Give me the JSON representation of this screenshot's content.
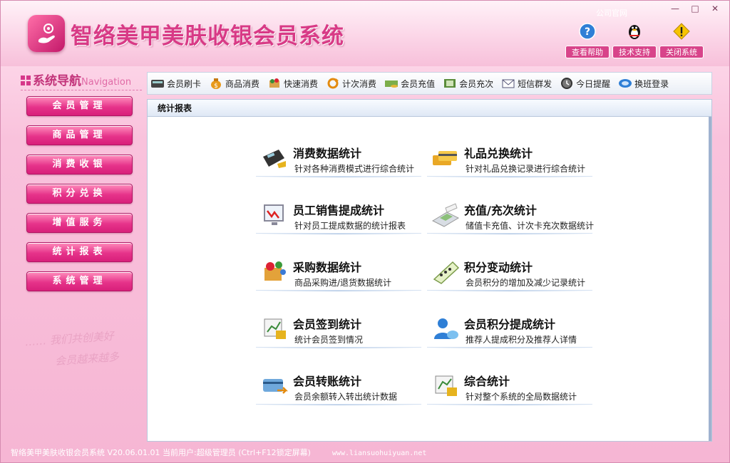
{
  "window": {
    "title": "智络美甲美肤收银会员系统",
    "official_site": "公司官网",
    "controls": [
      "—",
      "□",
      "✕"
    ]
  },
  "header_buttons": [
    {
      "label": "查看帮助",
      "icon": "help-icon"
    },
    {
      "label": "技术支持",
      "icon": "qq-penguin-icon"
    },
    {
      "label": "关闭系统",
      "icon": "warning-icon"
    }
  ],
  "sidebar": {
    "title": "系统导航",
    "title_en": "Navigation",
    "items": [
      {
        "label": "会员管理"
      },
      {
        "label": "商品管理"
      },
      {
        "label": "消费收银"
      },
      {
        "label": "积分兑换"
      },
      {
        "label": "增值服务"
      },
      {
        "label": "统计报表"
      },
      {
        "label": "系统管理"
      }
    ],
    "slogan_line1": "…… 我们共创美好",
    "slogan_line2": "会员越来越多"
  },
  "toolbar": [
    {
      "label": "会员刷卡",
      "icon": "card-reader-icon"
    },
    {
      "label": "商品消费",
      "icon": "money-bag-icon"
    },
    {
      "label": "快速消费",
      "icon": "fast-consume-icon"
    },
    {
      "label": "计次消费",
      "icon": "recycle-icon"
    },
    {
      "label": "会员充值",
      "icon": "recharge-icon"
    },
    {
      "label": "会员充次",
      "icon": "count-recharge-icon"
    },
    {
      "label": "短信群发",
      "icon": "sms-envelope-icon"
    },
    {
      "label": "今日提醒",
      "icon": "clock-icon"
    },
    {
      "label": "换班登录",
      "icon": "shift-login-icon"
    }
  ],
  "main": {
    "section_title": "统计报表",
    "stats": [
      {
        "title": "消费数据统计",
        "desc": "针对各种消费模式进行综合统计",
        "icon": "pos-machine-icon"
      },
      {
        "title": "礼品兑换统计",
        "desc": "针对礼品兑换记录进行综合统计",
        "icon": "cards-icon"
      },
      {
        "title": "员工销售提成统计",
        "desc": "针对员工提成数据的统计报表",
        "icon": "monitor-chart-icon"
      },
      {
        "title": "充值/充次统计",
        "desc": "储值卡充值、计次卡充次数据统计",
        "icon": "calculator-icon"
      },
      {
        "title": "采购数据统计",
        "desc": "商品采购进/退货数据统计",
        "icon": "purchase-box-icon"
      },
      {
        "title": "积分变动统计",
        "desc": "会员积分的增加及减少记录统计",
        "icon": "points-book-icon"
      },
      {
        "title": "会员签到统计",
        "desc": "统计会员签到情况",
        "icon": "signin-chart-icon"
      },
      {
        "title": "会员积分提成统计",
        "desc": "推荐人提成积分及推荐人详情",
        "icon": "user-points-icon"
      },
      {
        "title": "会员转账统计",
        "desc": "会员余额转入转出统计数据",
        "icon": "transfer-card-icon"
      },
      {
        "title": "综合统计",
        "desc": "针对整个系统的全局数据统计",
        "icon": "summary-chart-icon"
      }
    ]
  },
  "status": {
    "text": "智络美甲美肤收银会员系统 V20.06.01.01 当前用户:超级管理员 (Ctrl+F12锁定屏幕)",
    "url": "www.liansuohuiyuan.net"
  },
  "colors": {
    "brand_pink": "#d83a86",
    "nav_button": "#e6338a",
    "toolbar_bg": "#e9eef6"
  }
}
